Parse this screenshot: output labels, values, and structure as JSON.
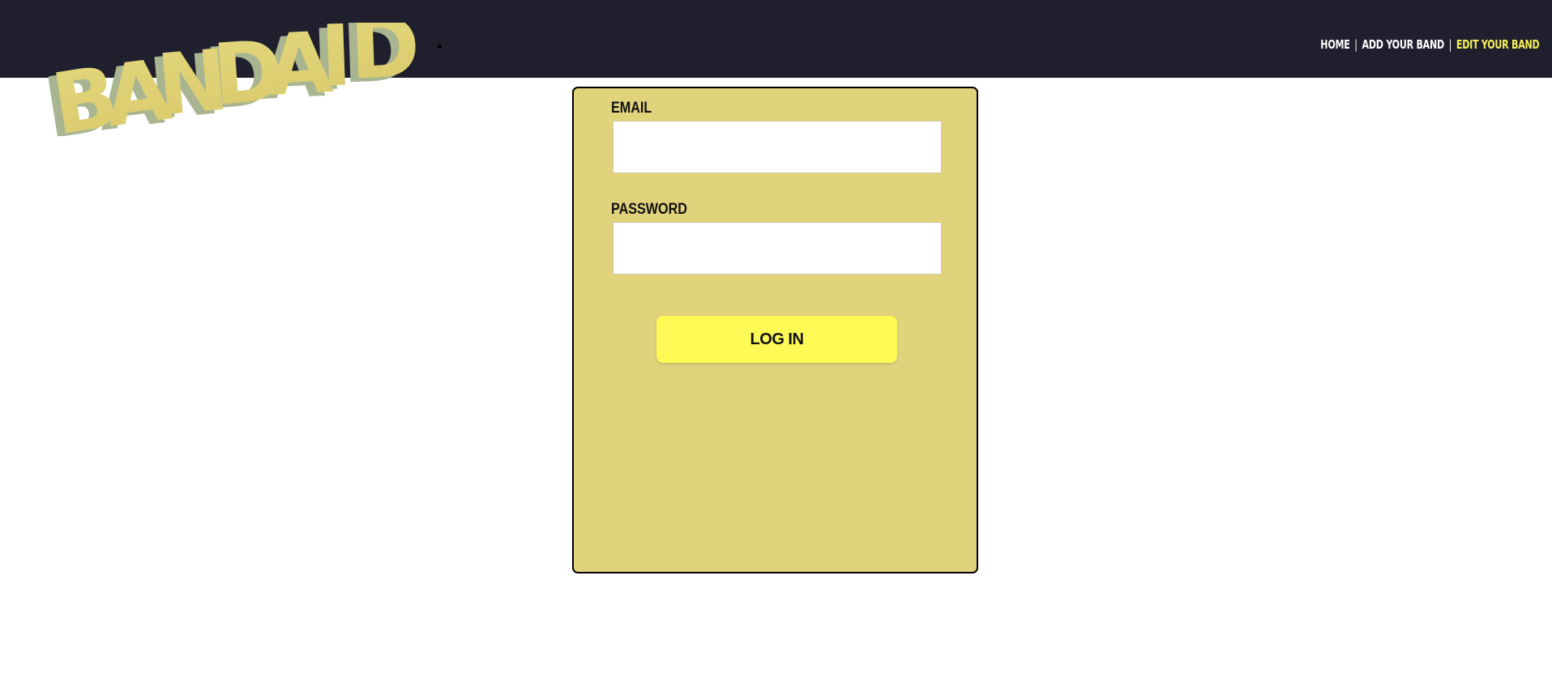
{
  "header": {
    "logo_text": "BANDAID",
    "background_color": "#1f1f2e"
  },
  "nav": {
    "items": [
      {
        "label": "HOME",
        "color": "#ffffff"
      },
      {
        "label": "ADD YOUR BAND",
        "color": "#ffffff"
      },
      {
        "label": "EDIT YOUR BAND",
        "color": "#f6ef5a"
      }
    ],
    "separator": "|"
  },
  "login_form": {
    "email_label": "EMAIL",
    "email_value": "",
    "password_label": "PASSWORD",
    "password_value": "",
    "submit_label": "LOG IN",
    "card_color": "#e1d27c",
    "button_color": "#fdf955"
  }
}
